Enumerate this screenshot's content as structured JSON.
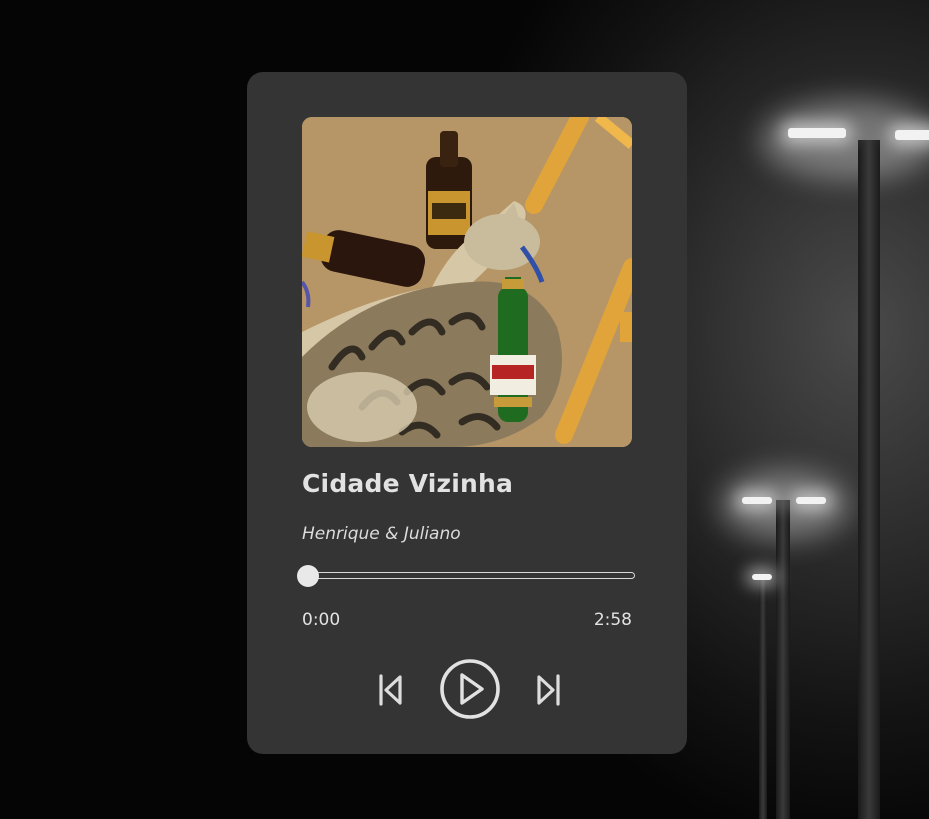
{
  "player": {
    "track_title": "Cidade Vizinha",
    "artist": "Henrique & Juliano",
    "current_time": "0:00",
    "total_time": "2:58",
    "progress": 0.0
  },
  "controls": {
    "previous_icon": "skip-previous-icon",
    "play_icon": "play-icon",
    "next_icon": "skip-next-icon"
  },
  "colors": {
    "card_background": "#343434",
    "text_primary": "#e2e2e2",
    "progress_track": "#d9d9d9",
    "page_background": "#050505"
  }
}
